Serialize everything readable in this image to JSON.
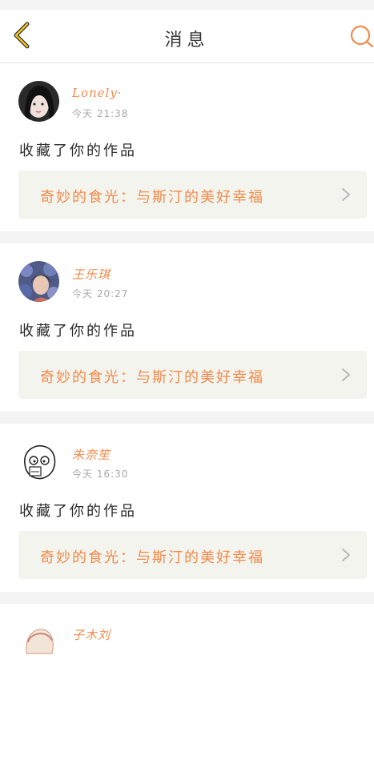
{
  "header": {
    "title": "消息",
    "back_icon": "chevron-left-icon",
    "search_icon": "search-icon",
    "accent": "#f0c419"
  },
  "messages": [
    {
      "username": "Lonely·",
      "time": "今天 21:38",
      "action": "收藏了你的作品",
      "work_title": "奇妙的食光：与斯汀的美好幸福"
    },
    {
      "username": "王乐琪",
      "time": "今天 20:27",
      "action": "收藏了你的作品",
      "work_title": "奇妙的食光：与斯汀的美好幸福"
    },
    {
      "username": "朱奈笙",
      "time": "今天 16:30",
      "action": "收藏了你的作品",
      "work_title": "奇妙的食光：与斯汀的美好幸福"
    },
    {
      "username": "子木刘"
    }
  ],
  "colors": {
    "accent_orange": "#f08a4b",
    "card_bg": "#ffffff",
    "page_bg": "#f3f3f3",
    "work_bg": "#f4f4ee"
  }
}
